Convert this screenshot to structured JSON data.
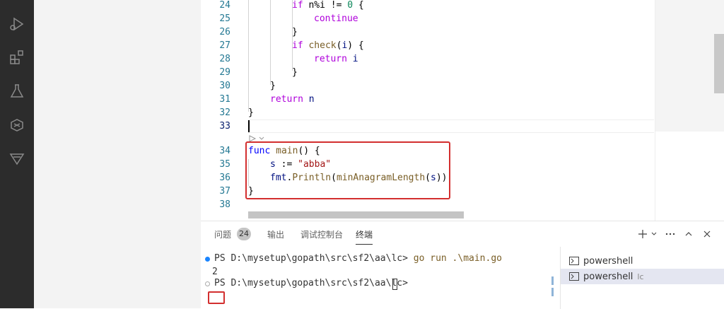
{
  "activity_bar": {
    "icons": [
      "run-debug-icon",
      "extensions-icon",
      "testing-icon",
      "go-gopher-icon",
      "filter-icon"
    ]
  },
  "editor": {
    "lines": [
      {
        "num": "24",
        "indent": 2
      },
      {
        "num": "25",
        "indent": 3
      },
      {
        "num": "26",
        "indent": 2
      },
      {
        "num": "27",
        "indent": 2
      },
      {
        "num": "28",
        "indent": 3
      },
      {
        "num": "29",
        "indent": 2
      },
      {
        "num": "30",
        "indent": 1
      },
      {
        "num": "31",
        "indent": 1
      },
      {
        "num": "32",
        "indent": 0
      },
      {
        "num": "33",
        "indent": 0
      },
      {
        "num": "34",
        "indent": 0
      },
      {
        "num": "35",
        "indent": 1
      },
      {
        "num": "36",
        "indent": 1
      },
      {
        "num": "37",
        "indent": 0
      },
      {
        "num": "38",
        "indent": 0
      }
    ],
    "code": {
      "l24": {
        "kw": "if",
        "rest": " n%i != ",
        "num": "0",
        "tail": " {"
      },
      "l25": {
        "kw": "continue"
      },
      "l26": {
        "text": "}"
      },
      "l27": {
        "kw": "if",
        "fn": "check",
        "var": "i",
        "tail": " {"
      },
      "l28": {
        "kw": "return",
        "var": "i"
      },
      "l29": {
        "text": "}"
      },
      "l30": {
        "text": "}"
      },
      "l31": {
        "kw": "return",
        "var": "n"
      },
      "l32": {
        "text": "}"
      },
      "l34": {
        "kw": "func",
        "fn": "main",
        "tail": "() {"
      },
      "l35": {
        "var": "s",
        "op": " := ",
        "str": "\"abba\""
      },
      "l36": {
        "pkg": "fmt",
        "fn": "Println",
        "fn2": "minAnagramLength",
        "var": "s"
      },
      "l37": {
        "text": "}"
      }
    }
  },
  "panel": {
    "tabs": [
      {
        "label": "问题",
        "active": false
      },
      {
        "label": "输出",
        "active": false
      },
      {
        "label": "调试控制台",
        "active": false
      },
      {
        "label": "终端",
        "active": true
      }
    ],
    "problems_count": "24",
    "actions": [
      "plus-icon",
      "chevron-down-icon",
      "more-icon",
      "chevron-up-icon",
      "close-icon"
    ]
  },
  "terminal": {
    "prompt": "PS D:\\mysetup\\gopath\\src\\sf2\\aa\\lc>",
    "command": "go run .\\main.go",
    "output": "2",
    "prompt2": "PS D:\\mysetup\\gopath\\src\\sf2\\aa\\lc>"
  },
  "terminal_list": [
    {
      "name": "powershell",
      "sub": "",
      "selected": false
    },
    {
      "name": "powershell",
      "sub": "lc",
      "selected": true
    }
  ],
  "colors": {
    "keyword": "#0000ff",
    "control": "#af00db",
    "string": "#a31515",
    "function": "#795e26",
    "variable": "#001080",
    "number": "#098658",
    "highlight": "#d32f2f"
  }
}
